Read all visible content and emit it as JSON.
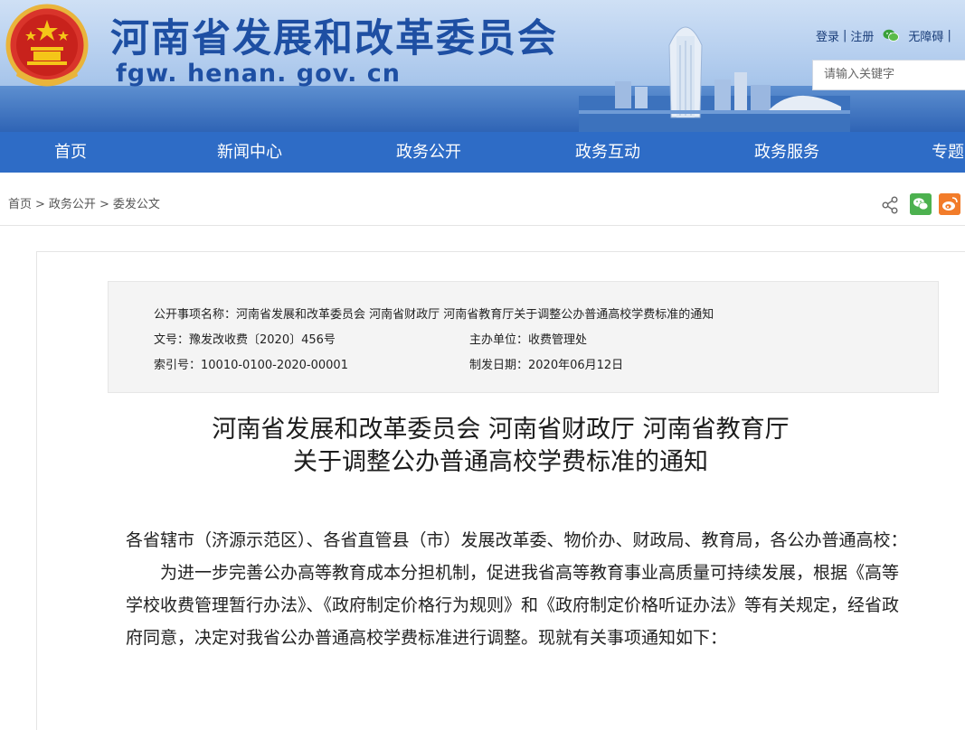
{
  "header": {
    "site_title": "河南省发展和改革委员会",
    "site_domain": "fgw. henan. gov. cn",
    "top_links": {
      "login": "登录",
      "divider": "|",
      "register": "注册",
      "accessibility": "无障碍",
      "extra": "|"
    },
    "search": {
      "placeholder": "请输入关键字"
    },
    "colors": {
      "brand_blue": "#1e4fa3",
      "nav_blue": "#2e6cc6"
    }
  },
  "nav": {
    "items": [
      {
        "label": "首页"
      },
      {
        "label": "新闻中心"
      },
      {
        "label": "政务公开"
      },
      {
        "label": "政务互动"
      },
      {
        "label": "政务服务"
      },
      {
        "label": "专题"
      }
    ]
  },
  "breadcrumb": {
    "items": [
      {
        "label": "首页"
      },
      {
        "label": "政务公开"
      },
      {
        "label": "委发公文"
      }
    ],
    "separator": ">"
  },
  "share": {
    "icons": [
      "share-icon",
      "wechat-icon",
      "weibo-icon"
    ]
  },
  "meta": {
    "item_name_label": "公开事项名称：",
    "item_name_value": "河南省发展和改革委员会 河南省财政厅 河南省教育厅关于调整公办普通高校学费标准的通知",
    "doc_no_label": "文号：",
    "doc_no_value": "豫发改收费〔2020〕456号",
    "sponsor_label": "主办单位：",
    "sponsor_value": "收费管理处",
    "index_label": "索引号：",
    "index_value": "10010-0100-2020-00001",
    "date_label": "制发日期：",
    "date_value": "2020年06月12日"
  },
  "document": {
    "title_line1": "河南省发展和改革委员会 河南省财政厅 河南省教育厅",
    "title_line2": "关于调整公办普通高校学费标准的通知",
    "salutation": "各省辖市（济源示范区）、各省直管县（市）发展改革委、物价办、财政局、教育局，各公办普通高校：",
    "paragraph1": "为进一步完善公办高等教育成本分担机制，促进我省高等教育事业高质量可持续发展，根据《高等学校收费管理暂行办法》、《政府制定价格行为规则》和《政府制定价格听证办法》等有关规定，经省政府同意，决定对我省公办普通高校学费标准进行调整。现就有关事项通知如下："
  }
}
